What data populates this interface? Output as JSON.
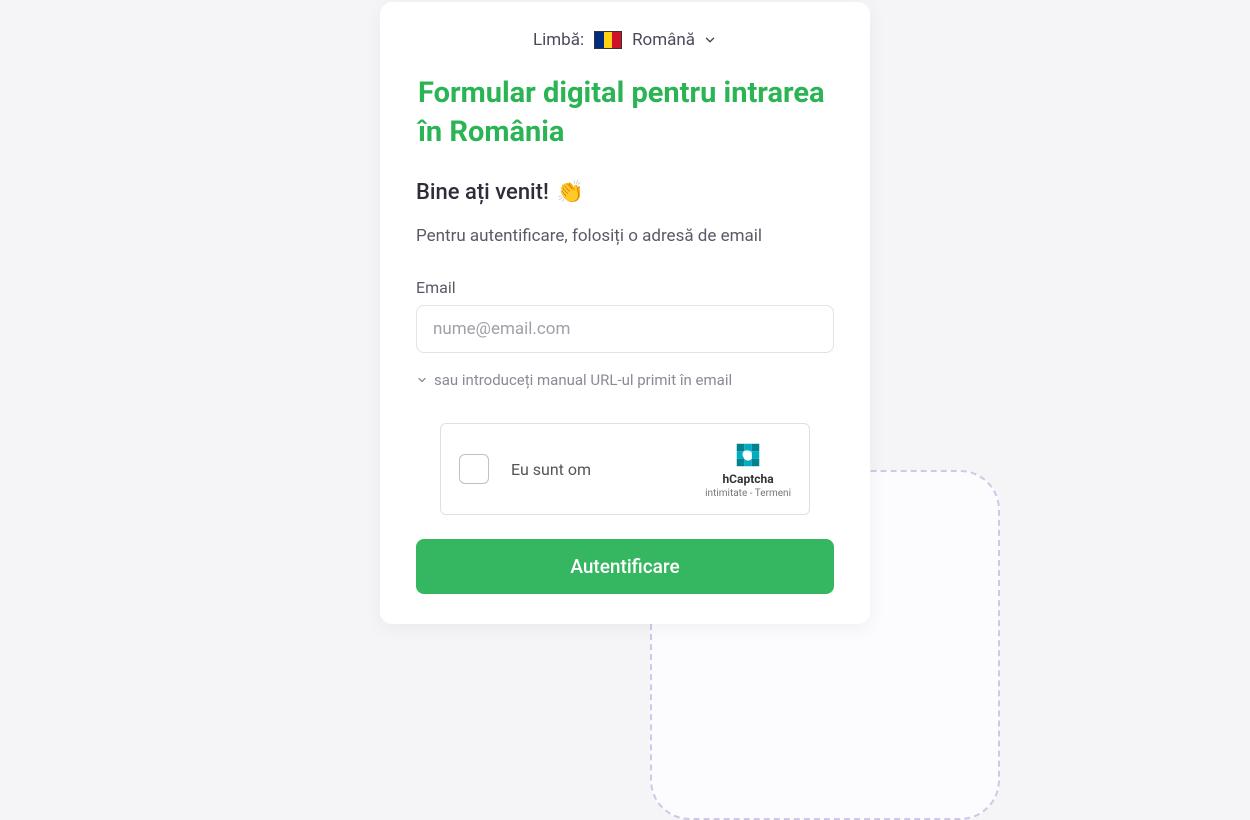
{
  "language": {
    "label": "Limbă:",
    "current": "Română"
  },
  "header": {
    "title": "Formular digital pentru intrarea în România"
  },
  "welcome": {
    "text": "Bine ați venit!",
    "emoji": "👏"
  },
  "instruction": "Pentru autentificare, folosiți o adresă de email",
  "email_field": {
    "label": "Email",
    "placeholder": "nume@email.com"
  },
  "expand": {
    "text": "sau introduceți manual URL-ul primit în email"
  },
  "captcha": {
    "label": "Eu sunt om",
    "brand": "hCaptcha",
    "privacy": "intimitate",
    "terms": "Termeni",
    "separator": " - "
  },
  "submit": {
    "label": "Autentificare"
  }
}
